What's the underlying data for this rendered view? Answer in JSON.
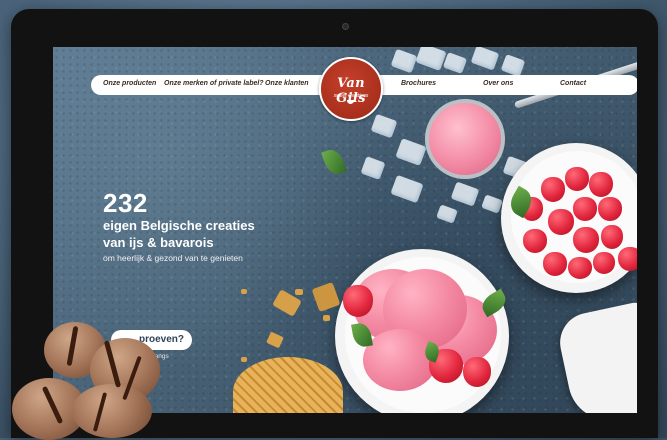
{
  "site": {
    "logo_name": "Van Gils",
    "logo_tagline": "sweet creations"
  },
  "nav": {
    "items": [
      {
        "label": "Onze producten"
      },
      {
        "label": "Onze merken of private label?"
      },
      {
        "label": "Onze klanten"
      },
      {
        "label": "Brochures"
      },
      {
        "label": "Over ons"
      },
      {
        "label": "Contact"
      }
    ]
  },
  "hero": {
    "count": "232",
    "line1": "eigen Belgische creaties",
    "line2": "van ijs & bavarois",
    "subtitle": "om heerlijk & gezond van te genieten"
  },
  "cta": {
    "label": "proeven?",
    "sub": "p afspraak langs"
  },
  "colors": {
    "brand_red": "#a92f1d",
    "background_slate": "#4a6479",
    "cta_text": "#2e4457"
  }
}
